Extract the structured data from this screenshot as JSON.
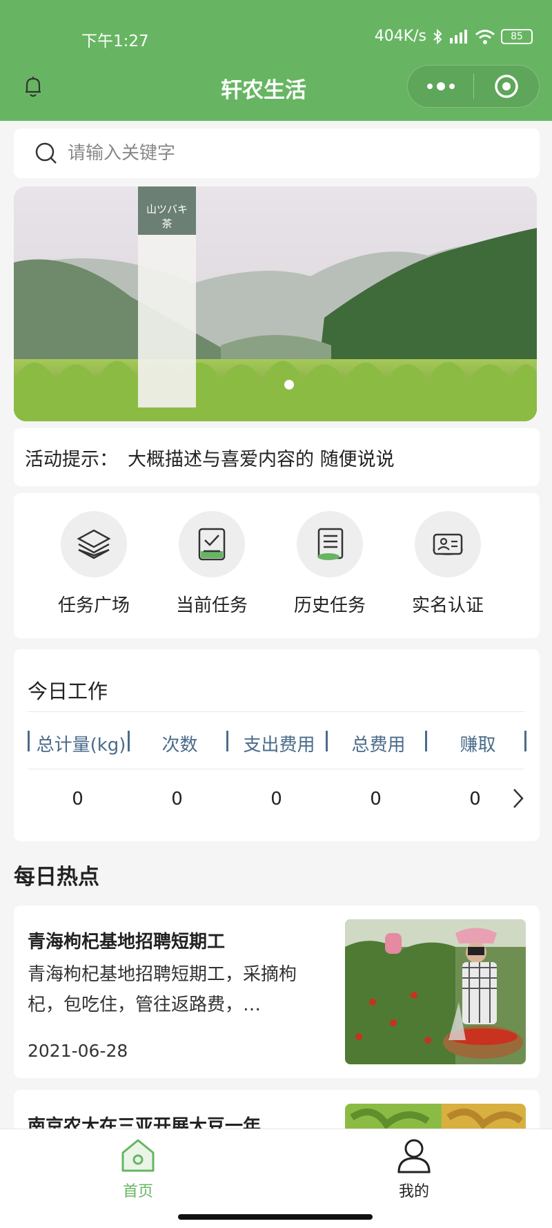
{
  "status_bar": {
    "time": "下午1:27",
    "network": "404K/s",
    "battery": "85"
  },
  "nav": {
    "title": "轩农生活"
  },
  "search": {
    "placeholder": "请输入关键字"
  },
  "banner": {
    "sign_text": "山ツバキ茶"
  },
  "notice": {
    "label": "活动提示：",
    "text": "大概描述与喜爱内容的 随便说说"
  },
  "quick_actions": [
    {
      "label": "任务广场",
      "icon": "layers-icon"
    },
    {
      "label": "当前任务",
      "icon": "task-check-icon"
    },
    {
      "label": "历史任务",
      "icon": "document-icon"
    },
    {
      "label": "实名认证",
      "icon": "id-card-icon"
    }
  ],
  "work": {
    "title": "今日工作",
    "columns": [
      "总计量(kg)",
      "次数",
      "支出费用",
      "总费用",
      "赚取"
    ],
    "values": [
      "0",
      "0",
      "0",
      "0",
      "0"
    ]
  },
  "hot": {
    "title": "每日热点",
    "items": [
      {
        "title": "青海枸杞基地招聘短期工",
        "summary": "青海枸杞基地招聘短期工，采摘枸杞，包吃住，管往返路费，…",
        "date": "2021-06-28"
      },
      {
        "title": "南京农大在三亚开展大豆一年…",
        "summary": "",
        "date": ""
      }
    ]
  },
  "tabbar": {
    "home": "首页",
    "mine": "我的"
  },
  "colors": {
    "primary": "#67b562",
    "header_text": "#4a6b8a"
  }
}
